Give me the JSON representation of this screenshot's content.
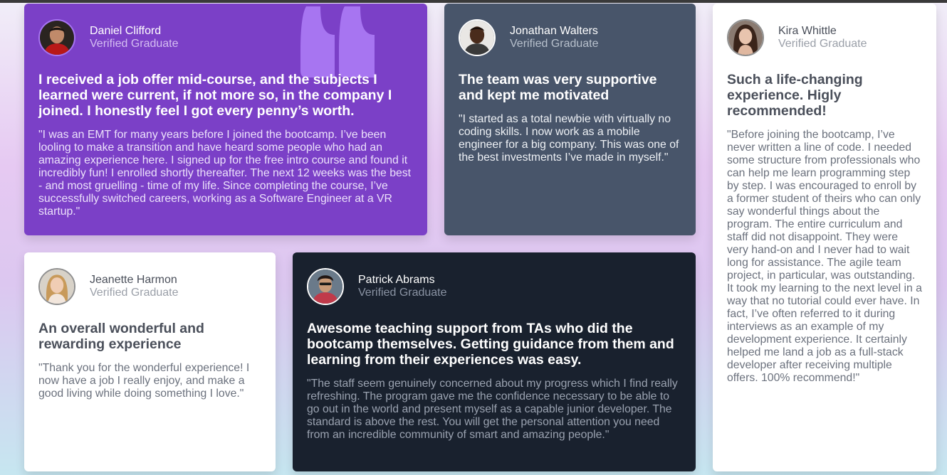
{
  "colors": {
    "purple": "#7b40c7",
    "slate": "#48556a",
    "white": "#ffffff",
    "dark": "#19212e",
    "quote_mark": "#a775f1"
  },
  "icons": {
    "quote": "quote-icon"
  },
  "testimonials": [
    {
      "name": "Daniel Clifford",
      "role": "Verified Graduate",
      "headline": "I received a job offer mid-course, and the subjects I learned were current, if not more so, in the company I joined. I honestly feel I got every penny’s worth.",
      "quote": "\"I was an EMT for many years before I joined the bootcamp. I’ve been looling to make a transition and have heard some people who had an amazing experience here. I signed up for the free intro course and found it incredibly fun! I enrolled shortly thereafter. The next 12 weeks was the best - and most gruelling - time of my life. Since completing the course, I’ve successfully switched careers, working as a Software Engineer at a VR startup.\""
    },
    {
      "name": "Jonathan Walters",
      "role": "Verified Graduate",
      "headline": "The team was very supportive and kept me motivated",
      "quote": "\"I started as a total newbie with virtually no coding skills. I now work as a mobile engineer for a big company. This was one of the best investments I’ve made in myself.\""
    },
    {
      "name": "Kira Whittle",
      "role": "Verified Graduate",
      "headline": "Such a life-changing experience. Higly recommended!",
      "quote": "\"Before joining the bootcamp, I’ve never written a line of code. I needed some structure from professionals who can help me learn programming step by step. I was encouraged to enroll by a former student of theirs who can only say wonderful things about the program. The entire curriculum and staff did not disappoint. They were very hand-on and I never had to wait long for assistance. The agile team project, in particular, was outstanding. It took my learning to the next level in a way that no tutorial could ever have. In fact, I’ve often referred to it during interviews as an example of my development experience. It certainly helped me land a job as a full-stack developer after receiving multiple offers. 100% recommend!\""
    },
    {
      "name": "Jeanette Harmon",
      "role": "Verified Graduate",
      "headline": "An overall wonderful and rewarding experience",
      "quote": "\"Thank you for the wonderful experience! I now have a job I really enjoy, and make a good living while doing something I love.\""
    },
    {
      "name": "Patrick Abrams",
      "role": "Verified Graduate",
      "headline": "Awesome teaching support from TAs who did the bootcamp themselves. Getting guidance from them and learning from their experiences was easy.",
      "quote": "\"The staff seem genuinely concerned about my progress which I find really refreshing. The program gave me the confidence necessary to be able to go out in the world and present myself as a capable junior developer. The standard is above the rest. You will get the personal attention you need from an incredible community of smart and amazing people.\""
    }
  ]
}
